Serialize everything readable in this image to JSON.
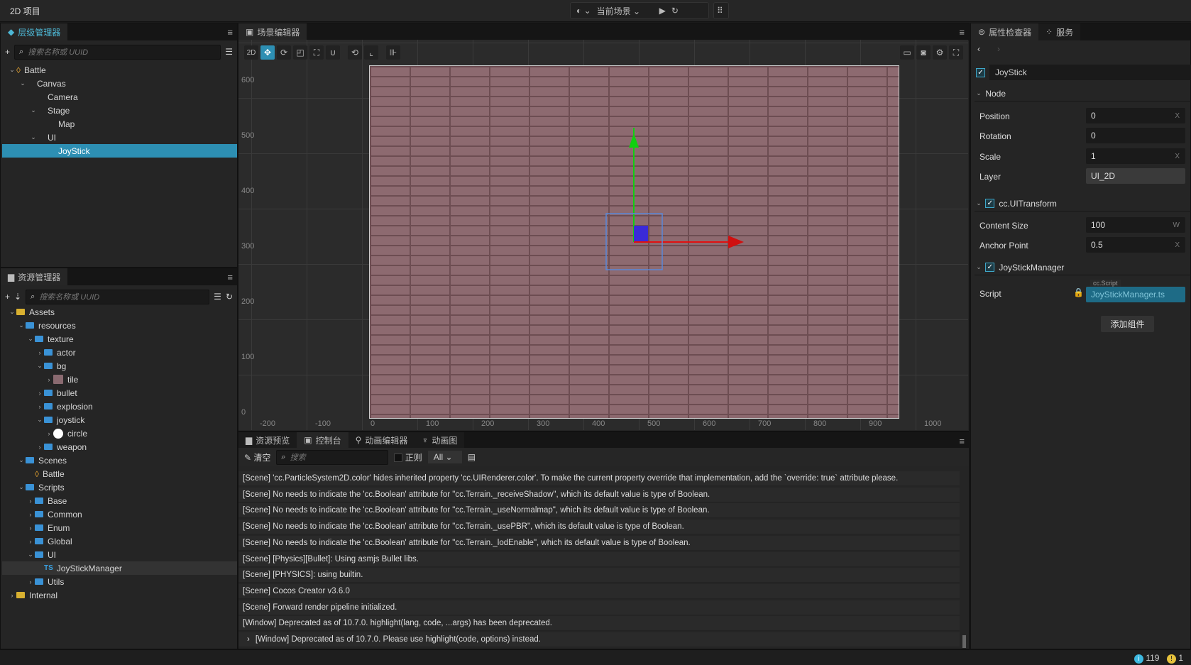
{
  "app": {
    "title": "2D 项目",
    "scene_select": "当前场景"
  },
  "hierarchy": {
    "tab": "层级管理器",
    "search_placeholder": "搜索名称或 UUID",
    "nodes": [
      {
        "label": "Battle",
        "depth": 0,
        "expanded": true
      },
      {
        "label": "Canvas",
        "depth": 1,
        "expanded": true
      },
      {
        "label": "Camera",
        "depth": 2
      },
      {
        "label": "Stage",
        "depth": 2,
        "expanded": true
      },
      {
        "label": "Map",
        "depth": 3
      },
      {
        "label": "UI",
        "depth": 2,
        "expanded": true
      },
      {
        "label": "JoyStick",
        "depth": 3,
        "selected": true
      }
    ]
  },
  "assets": {
    "tab": "资源管理器",
    "search_placeholder": "搜索名称或 UUID",
    "items": [
      {
        "label": "Assets",
        "depth": 0,
        "exp": "open",
        "kind": "db"
      },
      {
        "label": "resources",
        "depth": 1,
        "exp": "open",
        "kind": "folder"
      },
      {
        "label": "texture",
        "depth": 2,
        "exp": "open",
        "kind": "folder"
      },
      {
        "label": "actor",
        "depth": 3,
        "exp": "closed",
        "kind": "folder"
      },
      {
        "label": "bg",
        "depth": 3,
        "exp": "open",
        "kind": "folder"
      },
      {
        "label": "tile",
        "depth": 4,
        "exp": "closed",
        "kind": "image"
      },
      {
        "label": "bullet",
        "depth": 3,
        "exp": "closed",
        "kind": "folder"
      },
      {
        "label": "explosion",
        "depth": 3,
        "exp": "closed",
        "kind": "folder"
      },
      {
        "label": "joystick",
        "depth": 3,
        "exp": "open",
        "kind": "folder"
      },
      {
        "label": "circle",
        "depth": 4,
        "exp": "closed",
        "kind": "circle"
      },
      {
        "label": "weapon",
        "depth": 3,
        "exp": "closed",
        "kind": "folder"
      },
      {
        "label": "Scenes",
        "depth": 1,
        "exp": "open",
        "kind": "folder"
      },
      {
        "label": "Battle",
        "depth": 2,
        "kind": "scene"
      },
      {
        "label": "Scripts",
        "depth": 1,
        "exp": "open",
        "kind": "folder"
      },
      {
        "label": "Base",
        "depth": 2,
        "exp": "closed",
        "kind": "folder"
      },
      {
        "label": "Common",
        "depth": 2,
        "exp": "closed",
        "kind": "folder"
      },
      {
        "label": "Enum",
        "depth": 2,
        "exp": "closed",
        "kind": "folder"
      },
      {
        "label": "Global",
        "depth": 2,
        "exp": "closed",
        "kind": "folder"
      },
      {
        "label": "UI",
        "depth": 2,
        "exp": "open",
        "kind": "folder"
      },
      {
        "label": "JoyStickManager",
        "depth": 3,
        "kind": "ts",
        "highlight": true
      },
      {
        "label": "Utils",
        "depth": 2,
        "exp": "closed",
        "kind": "folder"
      },
      {
        "label": "Internal",
        "depth": 0,
        "exp": "closed",
        "kind": "db"
      }
    ]
  },
  "scene": {
    "tab": "场景编辑器",
    "mode": "2D",
    "y_ticks": [
      "600",
      "500",
      "400",
      "300",
      "200",
      "100",
      "0"
    ],
    "x_ticks": [
      "-200",
      "-100",
      "0",
      "100",
      "200",
      "300",
      "400",
      "500",
      "600",
      "700",
      "800",
      "900",
      "1000"
    ]
  },
  "console": {
    "tabs": [
      "资源预览",
      "控制台",
      "动画编辑器",
      "动画图"
    ],
    "active_tab": 1,
    "clear": "清空",
    "search_placeholder": "搜索",
    "regex": "正则",
    "level": "All",
    "logs": [
      "[Scene] 'cc.ParticleSystem2D.color' hides inherited property 'cc.UIRenderer.color'. To make the current property override that implementation, add the `override: true` attribute please.",
      "[Scene] No needs to indicate the 'cc.Boolean' attribute for \"cc.Terrain._receiveShadow\", which its default value is type of Boolean.",
      "[Scene] No needs to indicate the 'cc.Boolean' attribute for \"cc.Terrain._useNormalmap\", which its default value is type of Boolean.",
      "[Scene] No needs to indicate the 'cc.Boolean' attribute for \"cc.Terrain._usePBR\", which its default value is type of Boolean.",
      "[Scene] No needs to indicate the 'cc.Boolean' attribute for \"cc.Terrain._lodEnable\", which its default value is type of Boolean.",
      "[Scene] [Physics][Bullet]: Using asmjs Bullet libs.",
      "[Scene] [PHYSICS]: using builtin.",
      "[Scene] Cocos Creator v3.6.0",
      "[Scene] Forward render pipeline initialized.",
      "[Window] Deprecated as of 10.7.0. highlight(lang, code, ...args) has been deprecated.",
      "[Window] Deprecated as of 10.7.0. Please use highlight(code, options) instead."
    ]
  },
  "inspector": {
    "tabs": [
      "属性检查器",
      "服务"
    ],
    "node_name": "JoyStick",
    "node_section": "Node",
    "position_label": "Position",
    "position_x": "0",
    "rotation_label": "Rotation",
    "rotation": "0",
    "scale_label": "Scale",
    "scale_x": "1",
    "layer_label": "Layer",
    "layer": "UI_2D",
    "uitransform": "cc.UITransform",
    "content_size_label": "Content Size",
    "content_w": "100",
    "anchor_label": "Anchor Point",
    "anchor_x": "0.5",
    "component": "JoyStickManager",
    "script_label": "Script",
    "script_type": "cc.Script",
    "script": "JoyStickManager.ts",
    "add_component": "添加组件"
  },
  "status": {
    "info_count": "119",
    "warn_count": "1"
  },
  "colors": {
    "accent": "#2d8fb3",
    "x_axis": "#e01010",
    "y_axis": "#10d010"
  }
}
